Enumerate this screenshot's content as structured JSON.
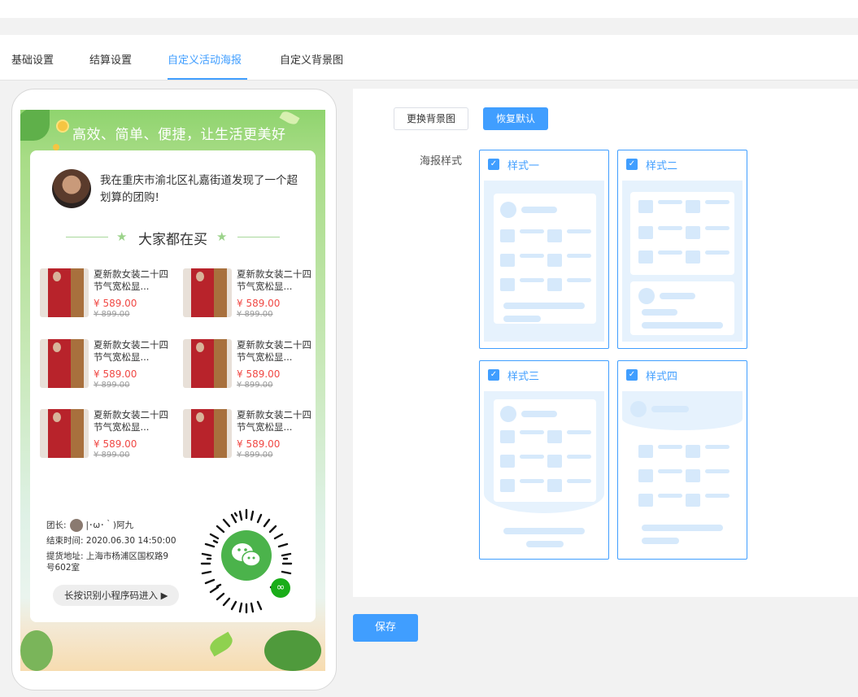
{
  "tabs": [
    {
      "label": "基础设置"
    },
    {
      "label": "结算设置"
    },
    {
      "label": "自定义活动海报"
    },
    {
      "label": "自定义背景图"
    }
  ],
  "poster": {
    "slogan": "高效、简单、便捷，让生活更美好",
    "intro": "我在重庆市渝北区礼嘉街道发现了一个超划算的团购!",
    "section_title": "大家都在买",
    "products": [
      {
        "name": "夏新款女装二十四节气宽松显...",
        "price": "¥ 589.00",
        "original": "¥ 899.00"
      },
      {
        "name": "夏新款女装二十四节气宽松显...",
        "price": "¥ 589.00",
        "original": "¥ 899.00"
      },
      {
        "name": "夏新款女装二十四节气宽松显...",
        "price": "¥ 589.00",
        "original": "¥ 899.00"
      },
      {
        "name": "夏新款女装二十四节气宽松显...",
        "price": "¥ 589.00",
        "original": "¥ 899.00"
      },
      {
        "name": "夏新款女装二十四节气宽松显...",
        "price": "¥ 589.00",
        "original": "¥ 899.00"
      },
      {
        "name": "夏新款女装二十四节气宽松显...",
        "price": "¥ 589.00",
        "original": "¥ 899.00"
      }
    ],
    "leader_label": "团长:",
    "leader_name": "|･ω･｀)阿九",
    "end_time_label": "结束时间:",
    "end_time": "2020.06.30 14:50:00",
    "pickup_label": "提货地址:",
    "pickup_address_1": "上海市杨浦区国权路9",
    "pickup_address_2": "号602室",
    "enter_button": "长按识别小程序码进入 ▶"
  },
  "panel": {
    "change_bg_button": "更换背景图",
    "restore_default_button": "恢复默认",
    "poster_style_label": "海报样式",
    "styles": [
      {
        "name": "样式一",
        "checked": true
      },
      {
        "name": "样式二",
        "checked": true
      },
      {
        "name": "样式三",
        "checked": true
      },
      {
        "name": "样式四",
        "checked": true
      }
    ]
  },
  "save_button": "保存",
  "colors": {
    "accent": "#409eff",
    "price": "#f04844",
    "poster_green": "#8fd46e"
  }
}
